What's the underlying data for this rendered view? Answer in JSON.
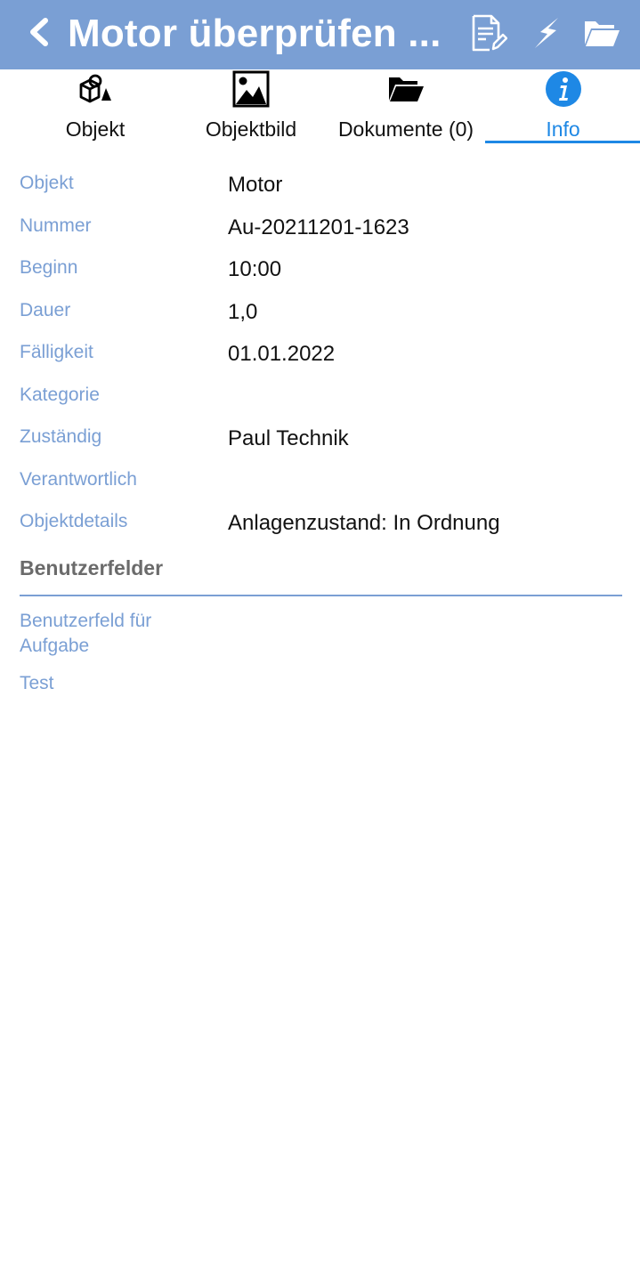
{
  "header": {
    "title": "Motor überprüfen ...",
    "icons": [
      "back-icon",
      "report-edit-icon",
      "flash-icon",
      "folder-open-icon"
    ],
    "background": "#7a9fd4"
  },
  "tabs": [
    {
      "label": "Objekt",
      "icon": "object-shapes-icon"
    },
    {
      "label": "Objektbild",
      "icon": "image-icon"
    },
    {
      "label": "Dokumente (0)",
      "icon": "folder-open-icon"
    },
    {
      "label": "Info",
      "icon": "info-icon",
      "active": true
    }
  ],
  "info": {
    "rows": [
      {
        "label": "Objekt",
        "value": "Motor"
      },
      {
        "label": "Nummer",
        "value": "Au-20211201-1623"
      },
      {
        "label": "Beginn",
        "value": "10:00"
      },
      {
        "label": "Dauer",
        "value": "1,0"
      },
      {
        "label": "Fälligkeit",
        "value": "01.01.2022"
      },
      {
        "label": "Kategorie",
        "value": ""
      },
      {
        "label": "Zuständig",
        "value": "Paul Technik"
      },
      {
        "label": "Verantwortlich",
        "value": ""
      },
      {
        "label": "Objektdetails",
        "value": "Anlagenzustand: In Ordnung"
      }
    ]
  },
  "user_fields": {
    "title": "Benutzerfelder",
    "fields": [
      {
        "label_line1": "Benutzerfeld für",
        "label_line2": "Aufgabe"
      },
      {
        "label_line1": "Test",
        "label_line2": ""
      }
    ]
  },
  "colors": {
    "accent": "#1e88e5",
    "label": "#7a9fd4"
  }
}
